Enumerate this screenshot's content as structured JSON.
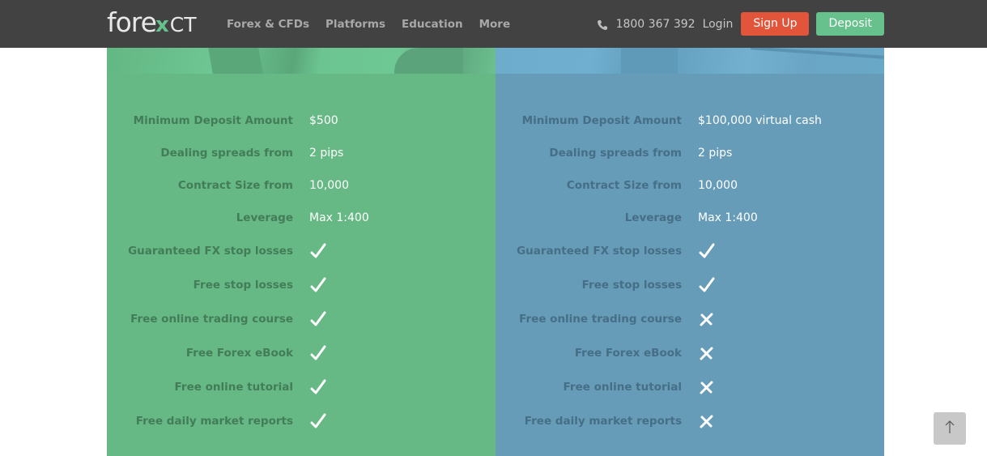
{
  "header": {
    "logo": {
      "part1": "fore",
      "part2": "x",
      "part3": "CT"
    },
    "nav": [
      {
        "label": "Forex & CFDs"
      },
      {
        "label": "Platforms"
      },
      {
        "label": "Education"
      },
      {
        "label": "More"
      }
    ],
    "phone_icon": "phone-icon",
    "phone": "1800 367 392",
    "login": "Login",
    "signup": "Sign Up",
    "deposit": "Deposit"
  },
  "colors": {
    "nav_bg": "#424242",
    "signup": "#e2553a",
    "deposit": "#66c18c",
    "live_panel": "#66b984",
    "demo_panel": "#669cb8"
  },
  "panels": [
    {
      "id": "live",
      "specs": [
        {
          "label": "Minimum Deposit Amount",
          "value": "$500"
        },
        {
          "label": "Dealing spreads from",
          "value": "2 pips"
        },
        {
          "label": "Contract Size from",
          "value": "10,000"
        },
        {
          "label": "Leverage",
          "value": "Max 1:400"
        }
      ],
      "features": [
        {
          "label": "Guaranteed FX stop losses",
          "included": true
        },
        {
          "label": "Free stop losses",
          "included": true
        },
        {
          "label": "Free online trading course",
          "included": true
        },
        {
          "label": "Free Forex eBook",
          "included": true
        },
        {
          "label": "Free online tutorial",
          "included": true
        },
        {
          "label": "Free daily market reports",
          "included": true
        }
      ]
    },
    {
      "id": "demo",
      "specs": [
        {
          "label": "Minimum Deposit Amount",
          "value": "$100,000 virtual cash"
        },
        {
          "label": "Dealing spreads from",
          "value": "2 pips"
        },
        {
          "label": "Contract Size from",
          "value": "10,000"
        },
        {
          "label": "Leverage",
          "value": "Max 1:400"
        }
      ],
      "features": [
        {
          "label": "Guaranteed FX stop losses",
          "included": true
        },
        {
          "label": "Free stop losses",
          "included": true
        },
        {
          "label": "Free online trading course",
          "included": false
        },
        {
          "label": "Free Forex eBook",
          "included": false
        },
        {
          "label": "Free online tutorial",
          "included": false
        },
        {
          "label": "Free daily market reports",
          "included": false
        }
      ]
    }
  ],
  "back_to_top_icon": "arrow-up-icon"
}
